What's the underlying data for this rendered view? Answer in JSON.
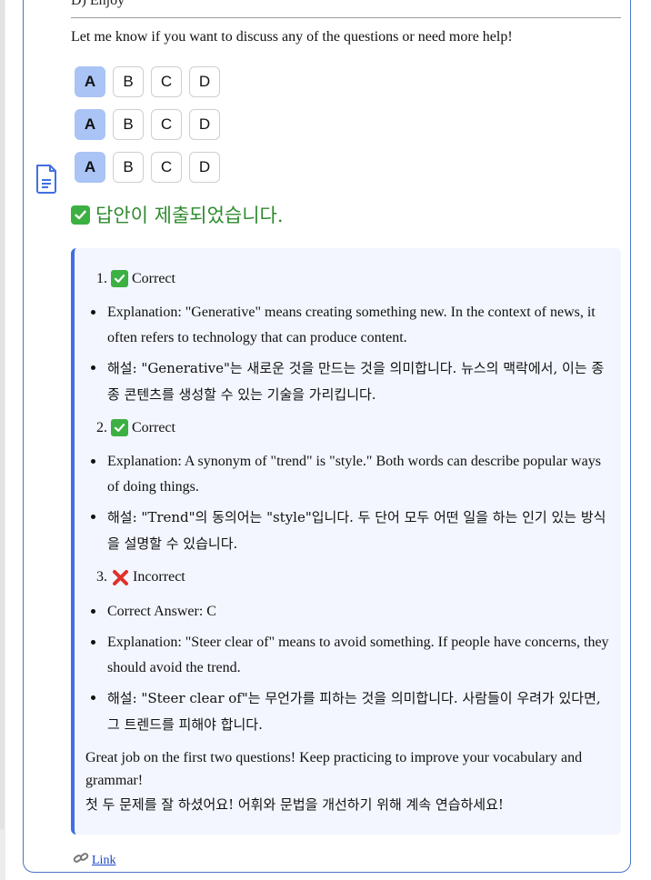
{
  "message": {
    "top_fragment": "D) Enjoy",
    "intro": "Let me know if you want to discuss any of the questions or need more help!",
    "choice_rows": [
      {
        "options": [
          "A",
          "B",
          "C",
          "D"
        ],
        "selected": "A"
      },
      {
        "options": [
          "A",
          "B",
          "C",
          "D"
        ],
        "selected": "A"
      },
      {
        "options": [
          "A",
          "B",
          "C",
          "D"
        ],
        "selected": "A"
      }
    ],
    "submitted_text": "답안이 제출되었습니다."
  },
  "feedback": {
    "q1": {
      "number": "1.",
      "status": "Correct",
      "status_icon": "check-mark-icon",
      "explanation": "Explanation: \"Generative\" means creating something new. In the context of news, it often refers to technology that can produce content.",
      "explanation_ko": "해설: \"Generative\"는 새로운 것을 만드는 것을 의미합니다. 뉴스의 맥락에서, 이는 종종 콘텐츠를 생성할 수 있는 기술을 가리킵니다."
    },
    "q2": {
      "number": "2.",
      "status": "Correct",
      "status_icon": "check-mark-icon",
      "explanation": "Explanation: A synonym of \"trend\" is \"style.\" Both words can describe popular ways of doing things.",
      "explanation_ko": "해설: \"Trend\"의 동의어는 \"style\"입니다. 두 단어 모두 어떤 일을 하는 인기 있는 방식을 설명할 수 있습니다."
    },
    "q3": {
      "number": "3.",
      "status": "Incorrect",
      "status_icon": "cross-mark-icon",
      "correct_answer": "Correct Answer: C",
      "explanation": "Explanation: \"Steer clear of\" means to avoid something. If people have concerns, they should avoid the trend.",
      "explanation_ko": "해설: \"Steer clear of\"는 무언가를 피하는 것을 의미합니다. 사람들이 우려가 있다면, 그 트렌드를 피해야 합니다."
    },
    "closing": "Great job on the first two questions! Keep practicing to improve your vocabulary and grammar!",
    "closing_ko": "첫 두 문제를 잘 하셨어요! 어휘와 문법을 개선하기 위해 계속 연습하세요!"
  },
  "footer": {
    "link_icon": "link-icon",
    "link_label": "Link"
  },
  "colors": {
    "card_border": "#4b74c9",
    "selected_choice": "#a9c4f5",
    "feedback_bg": "#f3f6fe",
    "feedback_accent": "#3f6fe3",
    "success_text": "#2f8a2f",
    "check_green": "#3cb043",
    "cross_red": "#e0312b",
    "link": "#1a47c9"
  }
}
